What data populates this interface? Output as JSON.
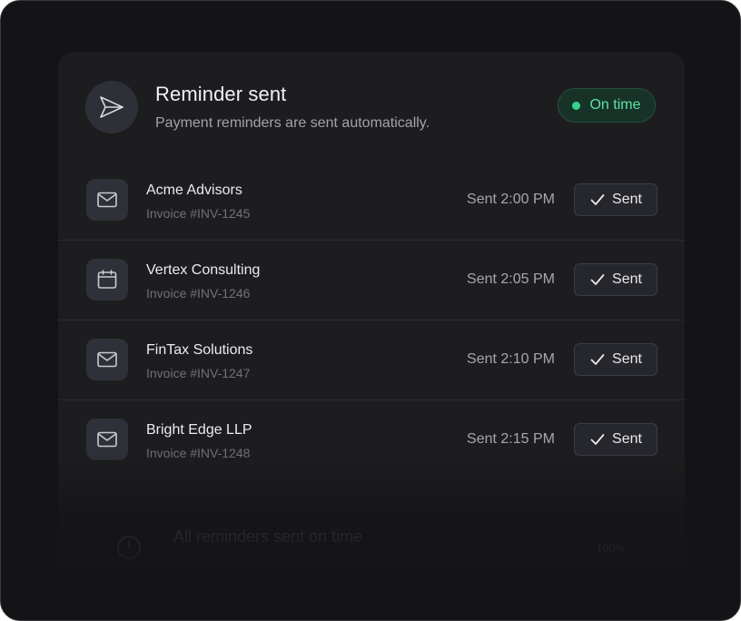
{
  "header": {
    "title": "Reminder sent",
    "subtitle": "Payment reminders are sent automatically.",
    "icon": "send-icon",
    "status": {
      "label": "On time",
      "color": "#34d48b"
    }
  },
  "reminders": [
    {
      "client": "Acme Advisors",
      "invoice": "Invoice #INV-1245",
      "time": "Sent 2:00 PM",
      "action": "Sent",
      "icon": "mail-icon"
    },
    {
      "client": "Vertex Consulting",
      "invoice": "Invoice #INV-1246",
      "time": "Sent 2:05 PM",
      "action": "Sent",
      "icon": "calendar-icon"
    },
    {
      "client": "FinTax Solutions",
      "invoice": "Invoice #INV-1247",
      "time": "Sent 2:10 PM",
      "action": "Sent",
      "icon": "mail-icon"
    },
    {
      "client": "Bright Edge LLP",
      "invoice": "Invoice #INV-1248",
      "time": "Sent 2:15 PM",
      "action": "Sent",
      "icon": "mail-icon"
    }
  ],
  "footer": {
    "text": "All reminders sent on time",
    "value": "100%",
    "icon": "clock-icon"
  },
  "colors": {
    "background": "#141416",
    "panel": "#1d1d20",
    "accent": "#34d48b"
  }
}
